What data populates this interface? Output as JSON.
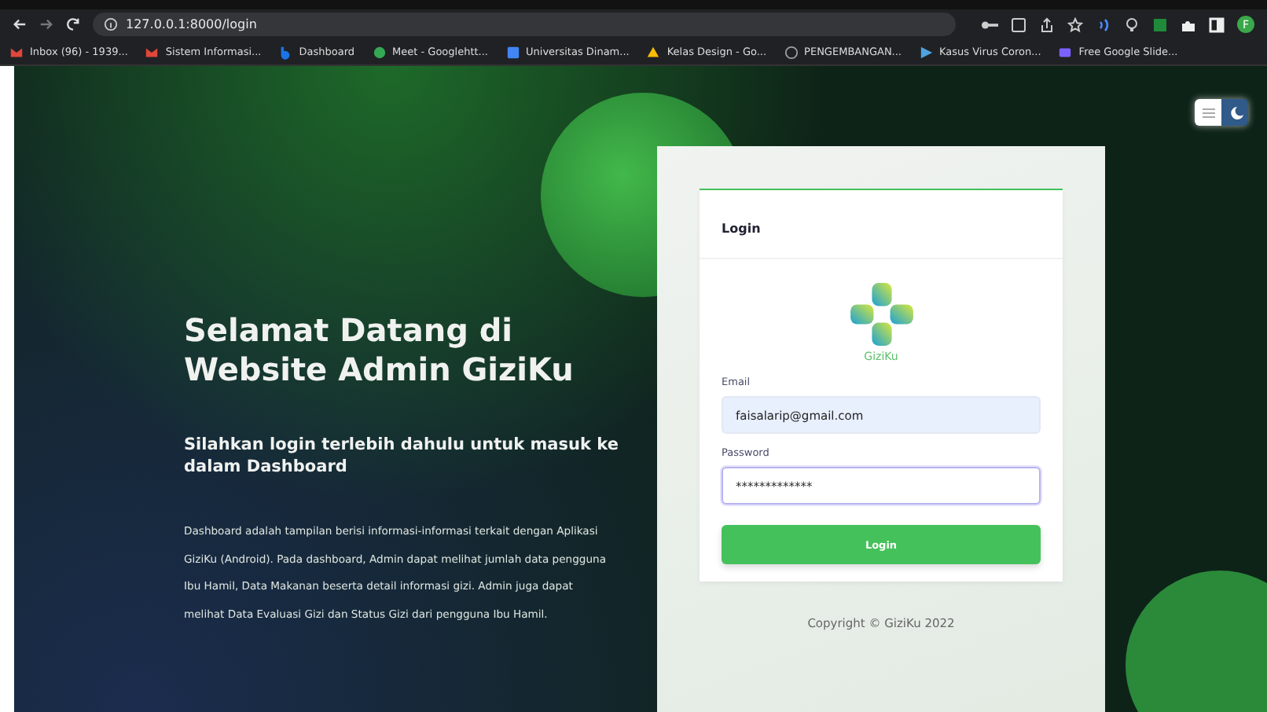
{
  "browser": {
    "url": "127.0.0.1:8000/login",
    "bookmarks": [
      {
        "label": "Inbox (96) - 1939...",
        "kind": "mail"
      },
      {
        "label": "Sistem Informasi...",
        "kind": "mail"
      },
      {
        "label": "Dashboard",
        "kind": "b"
      },
      {
        "label": "Meet - Googlehtt...",
        "kind": "meet"
      },
      {
        "label": "Universitas Dinam...",
        "kind": "square"
      },
      {
        "label": "Kelas Design - Go...",
        "kind": "drive"
      },
      {
        "label": "PENGEMBANGAN...",
        "kind": "globe"
      },
      {
        "label": "Kasus Virus Coron...",
        "kind": "arrow"
      },
      {
        "label": "Free Google Slide...",
        "kind": "slides"
      }
    ],
    "profile": "F"
  },
  "theme_toggle": [
    {
      "kind": "light",
      "selected": false
    },
    {
      "kind": "dark",
      "selected": true
    }
  ],
  "hero": {
    "title_lines": [
      "Selamat Datang di",
      "Website Admin GiziKu"
    ],
    "subtitle": "Silahkan login terlebih dahulu untuk masuk ke dalam Dashboard",
    "description": "Dashboard adalah tampilan berisi informasi-informasi terkait dengan Aplikasi GiziKu (Android). Pada dashboard, Admin dapat melihat jumlah data pengguna Ibu Hamil, Data Makanan beserta detail informasi gizi. Admin juga dapat melihat Data Evaluasi Gizi dan Status Gizi dari pengguna Ibu Hamil."
  },
  "login_card": {
    "title": "Login",
    "logo_text": "GiziKu",
    "fields": [
      {
        "label": "Email",
        "value": "faisalarip@gmail.com",
        "focused": false
      },
      {
        "label": "Password",
        "value": "*************",
        "focused": true
      }
    ],
    "button": "Login"
  },
  "footer": "Copyright © GiziKu 2022"
}
